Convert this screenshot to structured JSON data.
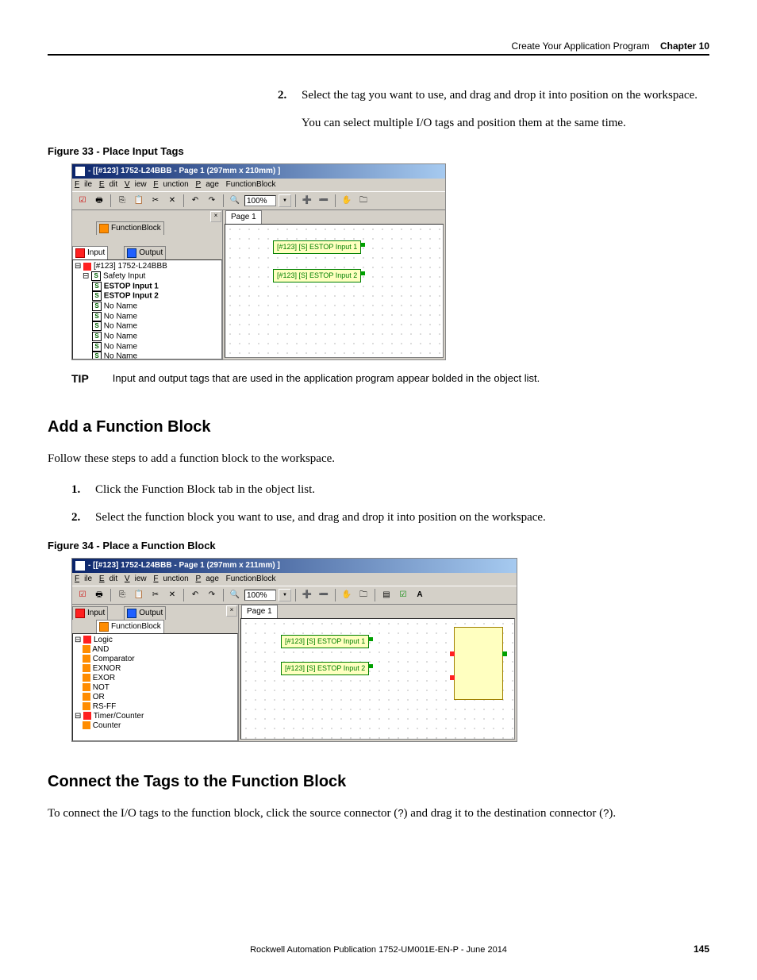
{
  "header": {
    "breadcrumb": "Create Your Application Program",
    "chapter": "Chapter 10"
  },
  "step_intro": {
    "step2_num": "2.",
    "step2_text": "Select the tag you want to use, and drag and drop it into position on the workspace.",
    "note": "You can select multiple I/O tags and position them at the same time."
  },
  "fig33": {
    "caption": "Figure 33 - Place Input Tags",
    "title": " - [[#123] 1752-L24BBB - Page 1 (297mm x 210mm) ]",
    "menus": {
      "file": "File",
      "edit": "Edit",
      "view": "View",
      "function": "Function",
      "page": "Page",
      "fblock": "FunctionBlock"
    },
    "zoom": "100%",
    "tabs": {
      "fb": "FunctionBlock",
      "input": "Input",
      "output": "Output"
    },
    "tree": {
      "root": "[#123] 1752-L24BBB",
      "safety": "Safety Input",
      "estop1": "ESTOP Input 1",
      "estop2": "ESTOP Input 2",
      "noname": "No Name"
    },
    "pagetab": "Page 1",
    "tags": {
      "t1": "[#123] [S] ESTOP Input 1",
      "t2": "[#123] [S] ESTOP Input 2"
    }
  },
  "tip": {
    "label": "TIP",
    "text": "Input and output tags that are used in the application program appear bolded in the object list."
  },
  "sectionA": {
    "heading": "Add a Function Block",
    "intro": "Follow these steps to add a function block to the workspace.",
    "step1_num": "1.",
    "step1": "Click the Function Block tab in the object list.",
    "step2_num": "2.",
    "step2": "Select the function block you want to use, and drag and drop it into position on the workspace."
  },
  "fig34": {
    "caption": "Figure 34 - Place a Function Block",
    "title": " - [[#123] 1752-L24BBB - Page 1 (297mm x 211mm) ]",
    "menus": {
      "file": "File",
      "edit": "Edit",
      "view": "View",
      "function": "Function",
      "page": "Page",
      "fblock": "FunctionBlock"
    },
    "zoom": "100%",
    "tabs": {
      "input": "Input",
      "output": "Output",
      "fb": "FunctionBlock"
    },
    "tree": {
      "logic": "Logic",
      "and": "AND",
      "comp": "Comparator",
      "exnor": "EXNOR",
      "exor": "EXOR",
      "not": "NOT",
      "or": "OR",
      "rsff": "RS-FF",
      "tc": "Timer/Counter",
      "counter": "Counter"
    },
    "pagetab": "Page 1",
    "tags": {
      "t1": "[#123] [S] ESTOP Input 1",
      "t2": "[#123] [S] ESTOP Input 2"
    }
  },
  "sectionB": {
    "heading": "Connect the Tags to the Function Block",
    "text_a": "To connect the I/O tags to the function block, click the source connector (",
    "text_b": ") and drag it to the destination connector (",
    "text_c": ")."
  },
  "footer": {
    "pub": "Rockwell Automation Publication 1752-UM001E-EN-P - June 2014",
    "page": "145"
  },
  "glyphs": {
    "conn1": "?",
    "conn2": "?"
  }
}
